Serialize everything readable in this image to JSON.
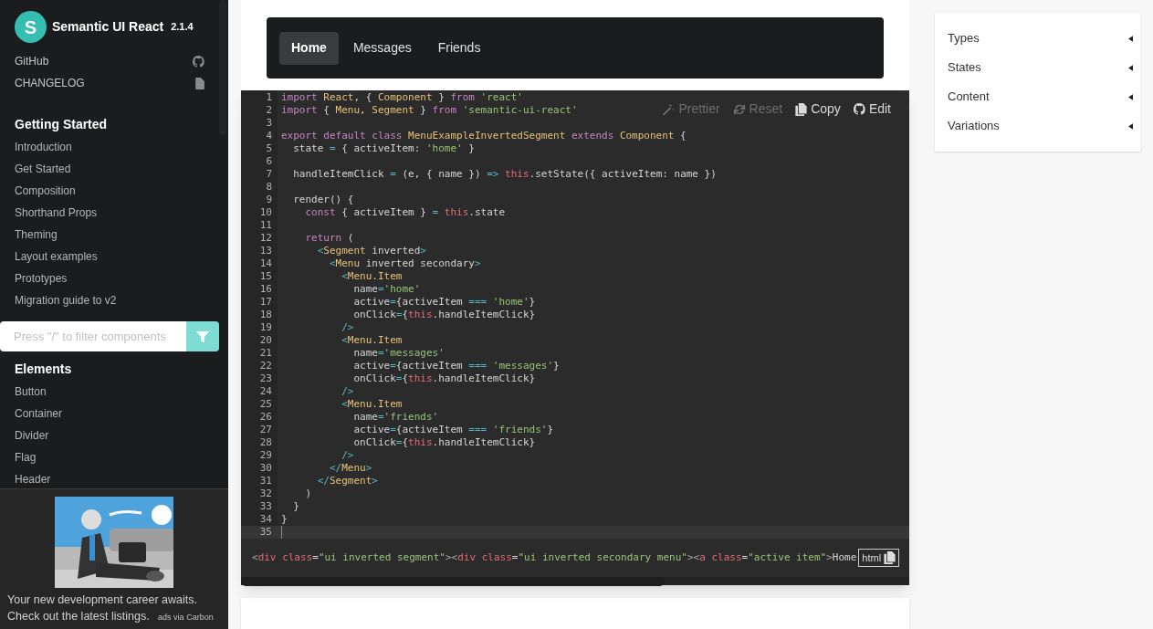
{
  "sidebar": {
    "logo_letter": "S",
    "title": "Semantic UI React",
    "version": "2.1.4",
    "links": [
      {
        "label": "GitHub"
      },
      {
        "label": "CHANGELOG"
      }
    ],
    "sections": [
      {
        "heading": "Getting Started",
        "items": [
          "Introduction",
          "Get Started",
          "Composition",
          "Shorthand Props",
          "Theming",
          "Layout examples",
          "Prototypes",
          "Migration guide to v2"
        ]
      }
    ],
    "filter": {
      "placeholder": "Press \"/\" to filter components"
    },
    "sections_after_filter": [
      {
        "heading": "Elements",
        "items": [
          "Button",
          "Container",
          "Divider",
          "Flag",
          "Header"
        ]
      }
    ],
    "ad": {
      "text": "Your new development career awaits. Check out the latest listings.",
      "via": "ads via Carbon"
    }
  },
  "example_menu": [
    {
      "label": "Home",
      "selected": true
    },
    {
      "label": "Messages",
      "selected": false
    },
    {
      "label": "Friends",
      "selected": false
    }
  ],
  "editor_toolbar": [
    {
      "label": "Prettier",
      "disabled": true
    },
    {
      "label": "Reset",
      "disabled": true
    },
    {
      "label": "Copy",
      "disabled": false
    },
    {
      "label": "Edit",
      "disabled": false
    }
  ],
  "code_lines": [
    {
      "n": "1",
      "current": false,
      "tokens": [
        {
          "kind": "k",
          "text": "import "
        },
        {
          "kind": "c",
          "text": "React"
        },
        {
          "kind": "p",
          "text": ", { "
        },
        {
          "kind": "c",
          "text": "Component"
        },
        {
          "kind": "p",
          "text": " } "
        },
        {
          "kind": "k",
          "text": "from "
        },
        {
          "kind": "s",
          "text": "'react'"
        }
      ]
    },
    {
      "n": "2",
      "current": false,
      "tokens": [
        {
          "kind": "k",
          "text": "import "
        },
        {
          "kind": "p",
          "text": "{ "
        },
        {
          "kind": "c",
          "text": "Menu"
        },
        {
          "kind": "p",
          "text": ", "
        },
        {
          "kind": "c",
          "text": "Segment"
        },
        {
          "kind": "p",
          "text": " } "
        },
        {
          "kind": "k",
          "text": "from "
        },
        {
          "kind": "s",
          "text": "'semantic-ui-react'"
        }
      ]
    },
    {
      "n": "3",
      "current": false
    },
    {
      "n": "4",
      "current": false,
      "tokens": [
        {
          "kind": "k",
          "text": "export default class "
        },
        {
          "kind": "c",
          "text": "MenuExampleInvertedSegment "
        },
        {
          "kind": "k",
          "text": "extends "
        },
        {
          "kind": "c",
          "text": "Component "
        },
        {
          "kind": "p",
          "text": "{"
        }
      ]
    },
    {
      "n": "5",
      "current": false,
      "tokens": [
        {
          "kind": "p",
          "text": "  state "
        },
        {
          "kind": "o",
          "text": "="
        },
        {
          "kind": "p",
          "text": " { activeItem: "
        },
        {
          "kind": "s",
          "text": "'home'"
        },
        {
          "kind": "p",
          "text": " }"
        }
      ]
    },
    {
      "n": "6",
      "current": false
    },
    {
      "n": "7",
      "current": false,
      "tokens": [
        {
          "kind": "p",
          "text": "  handleItemClick "
        },
        {
          "kind": "o",
          "text": "="
        },
        {
          "kind": "p",
          "text": " (e, { name }) "
        },
        {
          "kind": "o",
          "text": "=> "
        },
        {
          "kind": "t",
          "text": "this"
        },
        {
          "kind": "p",
          "text": ".setState({ activeItem: name })"
        }
      ]
    },
    {
      "n": "8",
      "current": false
    },
    {
      "n": "9",
      "current": false,
      "tokens": [
        {
          "kind": "p",
          "text": "  render() {"
        }
      ]
    },
    {
      "n": "10",
      "current": false,
      "tokens": [
        {
          "kind": "k",
          "text": "    const "
        },
        {
          "kind": "p",
          "text": "{ activeItem } "
        },
        {
          "kind": "o",
          "text": "= "
        },
        {
          "kind": "t",
          "text": "this"
        },
        {
          "kind": "p",
          "text": ".state"
        }
      ]
    },
    {
      "n": "11",
      "current": false
    },
    {
      "n": "12",
      "current": false,
      "tokens": [
        {
          "kind": "k",
          "text": "    return "
        },
        {
          "kind": "p",
          "text": "("
        }
      ]
    },
    {
      "n": "13",
      "current": false,
      "tokens": [
        {
          "kind": "o",
          "text": "      <"
        },
        {
          "kind": "c",
          "text": "Segment"
        },
        {
          "kind": "p",
          "text": " inverted"
        },
        {
          "kind": "o",
          "text": ">"
        }
      ]
    },
    {
      "n": "14",
      "current": false,
      "tokens": [
        {
          "kind": "o",
          "text": "        <"
        },
        {
          "kind": "c",
          "text": "Menu"
        },
        {
          "kind": "p",
          "text": " inverted secondary"
        },
        {
          "kind": "o",
          "text": ">"
        }
      ]
    },
    {
      "n": "15",
      "current": false,
      "tokens": [
        {
          "kind": "o",
          "text": "          <"
        },
        {
          "kind": "c",
          "text": "Menu.Item"
        }
      ]
    },
    {
      "n": "16",
      "current": false,
      "tokens": [
        {
          "kind": "p",
          "text": "            name"
        },
        {
          "kind": "o",
          "text": "="
        },
        {
          "kind": "s",
          "text": "'home'"
        }
      ]
    },
    {
      "n": "17",
      "current": false,
      "tokens": [
        {
          "kind": "p",
          "text": "            active"
        },
        {
          "kind": "o",
          "text": "="
        },
        {
          "kind": "p",
          "text": "{activeItem "
        },
        {
          "kind": "o",
          "text": "=== "
        },
        {
          "kind": "s",
          "text": "'home'"
        },
        {
          "kind": "p",
          "text": "}"
        }
      ]
    },
    {
      "n": "18",
      "current": false,
      "tokens": [
        {
          "kind": "p",
          "text": "            onClick"
        },
        {
          "kind": "o",
          "text": "="
        },
        {
          "kind": "p",
          "text": "{"
        },
        {
          "kind": "t",
          "text": "this"
        },
        {
          "kind": "p",
          "text": ".handleItemClick}"
        }
      ]
    },
    {
      "n": "19",
      "current": false,
      "tokens": [
        {
          "kind": "o",
          "text": "          />"
        }
      ]
    },
    {
      "n": "20",
      "current": false,
      "tokens": [
        {
          "kind": "o",
          "text": "          <"
        },
        {
          "kind": "c",
          "text": "Menu.Item"
        }
      ]
    },
    {
      "n": "21",
      "current": false,
      "tokens": [
        {
          "kind": "p",
          "text": "            name"
        },
        {
          "kind": "o",
          "text": "="
        },
        {
          "kind": "s",
          "text": "'messages'"
        }
      ]
    },
    {
      "n": "22",
      "current": false,
      "tokens": [
        {
          "kind": "p",
          "text": "            active"
        },
        {
          "kind": "o",
          "text": "="
        },
        {
          "kind": "p",
          "text": "{activeItem "
        },
        {
          "kind": "o",
          "text": "=== "
        },
        {
          "kind": "s",
          "text": "'messages'"
        },
        {
          "kind": "p",
          "text": "}"
        }
      ]
    },
    {
      "n": "23",
      "current": false,
      "tokens": [
        {
          "kind": "p",
          "text": "            onClick"
        },
        {
          "kind": "o",
          "text": "="
        },
        {
          "kind": "p",
          "text": "{"
        },
        {
          "kind": "t",
          "text": "this"
        },
        {
          "kind": "p",
          "text": ".handleItemClick}"
        }
      ]
    },
    {
      "n": "24",
      "current": false,
      "tokens": [
        {
          "kind": "o",
          "text": "          />"
        }
      ]
    },
    {
      "n": "25",
      "current": false,
      "tokens": [
        {
          "kind": "o",
          "text": "          <"
        },
        {
          "kind": "c",
          "text": "Menu.Item"
        }
      ]
    },
    {
      "n": "26",
      "current": false,
      "tokens": [
        {
          "kind": "p",
          "text": "            name"
        },
        {
          "kind": "o",
          "text": "="
        },
        {
          "kind": "s",
          "text": "'friends'"
        }
      ]
    },
    {
      "n": "27",
      "current": false,
      "tokens": [
        {
          "kind": "p",
          "text": "            active"
        },
        {
          "kind": "o",
          "text": "="
        },
        {
          "kind": "p",
          "text": "{activeItem "
        },
        {
          "kind": "o",
          "text": "=== "
        },
        {
          "kind": "s",
          "text": "'friends'"
        },
        {
          "kind": "p",
          "text": "}"
        }
      ]
    },
    {
      "n": "28",
      "current": false,
      "tokens": [
        {
          "kind": "p",
          "text": "            onClick"
        },
        {
          "kind": "o",
          "text": "="
        },
        {
          "kind": "p",
          "text": "{"
        },
        {
          "kind": "t",
          "text": "this"
        },
        {
          "kind": "p",
          "text": ".handleItemClick}"
        }
      ]
    },
    {
      "n": "29",
      "current": false,
      "tokens": [
        {
          "kind": "o",
          "text": "          />"
        }
      ]
    },
    {
      "n": "30",
      "current": false,
      "tokens": [
        {
          "kind": "o",
          "text": "        </"
        },
        {
          "kind": "c",
          "text": "Menu"
        },
        {
          "kind": "o",
          "text": ">"
        }
      ]
    },
    {
      "n": "31",
      "current": false,
      "tokens": [
        {
          "kind": "o",
          "text": "      </"
        },
        {
          "kind": "c",
          "text": "Segment"
        },
        {
          "kind": "o",
          "text": ">"
        }
      ]
    },
    {
      "n": "32",
      "current": false,
      "tokens": [
        {
          "kind": "p",
          "text": "    )"
        }
      ]
    },
    {
      "n": "33",
      "current": false,
      "tokens": [
        {
          "kind": "p",
          "text": "  }"
        }
      ]
    },
    {
      "n": "34",
      "current": false,
      "tokens": [
        {
          "kind": "p",
          "text": "}"
        }
      ]
    },
    {
      "n": "35",
      "current": true
    }
  ],
  "html_preview": {
    "tokens": [
      {
        "kind": "g",
        "text": "<"
      },
      {
        "kind": "t",
        "text": "div "
      },
      {
        "kind": "t",
        "text": "class"
      },
      {
        "kind": "p",
        "text": "="
      },
      {
        "kind": "s",
        "text": "\"ui inverted segment\""
      },
      {
        "kind": "g",
        "text": "><"
      },
      {
        "kind": "t",
        "text": "div "
      },
      {
        "kind": "t",
        "text": "class"
      },
      {
        "kind": "p",
        "text": "="
      },
      {
        "kind": "s",
        "text": "\"ui inverted secondary menu\""
      },
      {
        "kind": "g",
        "text": "><"
      },
      {
        "kind": "t",
        "text": "a "
      },
      {
        "kind": "t",
        "text": "class"
      },
      {
        "kind": "p",
        "text": "="
      },
      {
        "kind": "s",
        "text": "\"active item\""
      },
      {
        "kind": "g",
        "text": ">"
      },
      {
        "kind": "p",
        "text": "Home"
      }
    ],
    "badge": "html"
  },
  "toc": [
    {
      "label": "Types"
    },
    {
      "label": "States"
    },
    {
      "label": "Content"
    },
    {
      "label": "Variations"
    }
  ]
}
